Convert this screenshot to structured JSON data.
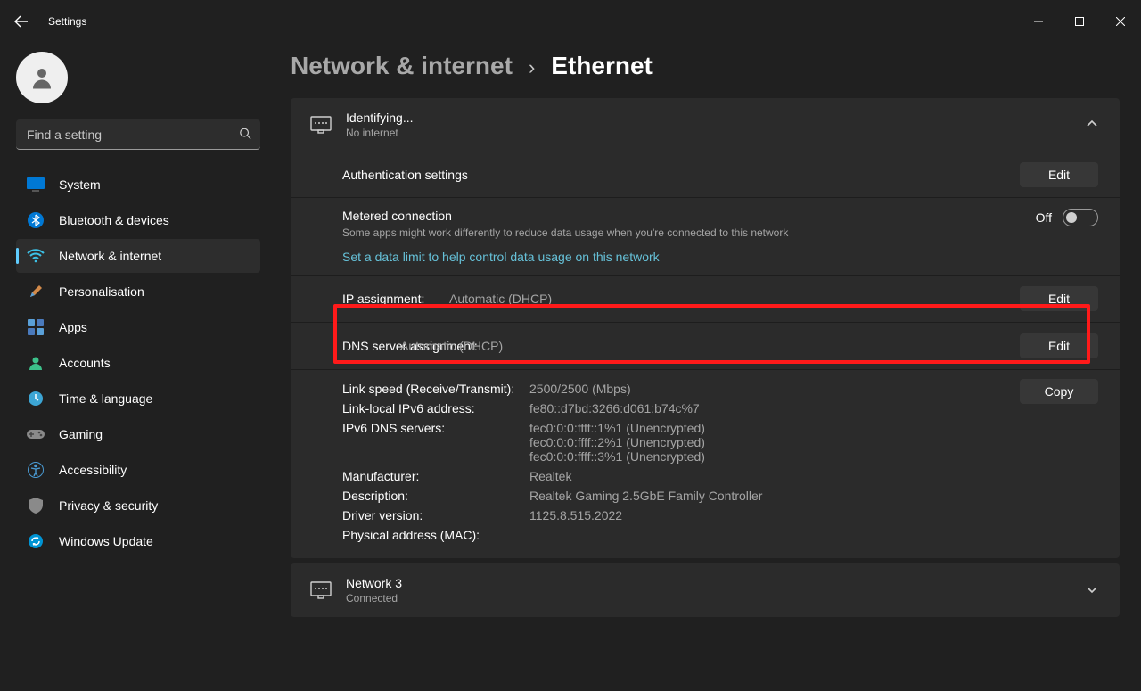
{
  "window": {
    "title": "Settings"
  },
  "search": {
    "placeholder": "Find a setting"
  },
  "sidebar": {
    "items": [
      {
        "label": "System"
      },
      {
        "label": "Bluetooth & devices"
      },
      {
        "label": "Network & internet"
      },
      {
        "label": "Personalisation"
      },
      {
        "label": "Apps"
      },
      {
        "label": "Accounts"
      },
      {
        "label": "Time & language"
      },
      {
        "label": "Gaming"
      },
      {
        "label": "Accessibility"
      },
      {
        "label": "Privacy & security"
      },
      {
        "label": "Windows Update"
      }
    ],
    "active_index": 2
  },
  "breadcrumb": {
    "parent": "Network & internet",
    "current": "Ethernet"
  },
  "adapter_card": {
    "title": "Identifying...",
    "subtitle": "No internet",
    "auth_label": "Authentication settings",
    "auth_button": "Edit",
    "metered_label": "Metered connection",
    "metered_desc": "Some apps might work differently to reduce data usage when you're connected to this network",
    "metered_state_label": "Off",
    "data_limit_link": "Set a data limit to help control data usage on this network",
    "ip_assignment_label": "IP assignment:",
    "ip_assignment_value": "Automatic (DHCP)",
    "ip_assignment_button": "Edit",
    "dns_assignment_label": "DNS server assignment:",
    "dns_assignment_value": "Automatic (DHCP)",
    "dns_assignment_button": "Edit",
    "copy_button": "Copy",
    "details": {
      "link_speed_label": "Link speed (Receive/Transmit):",
      "link_speed_value": "2500/2500 (Mbps)",
      "link_local_label": "Link-local IPv6 address:",
      "link_local_value": "fe80::d7bd:3266:d061:b74c%7",
      "dns_servers_label": "IPv6 DNS servers:",
      "dns_servers_value_1": "fec0:0:0:ffff::1%1 (Unencrypted)",
      "dns_servers_value_2": "fec0:0:0:ffff::2%1 (Unencrypted)",
      "dns_servers_value_3": "fec0:0:0:ffff::3%1 (Unencrypted)",
      "manufacturer_label": "Manufacturer:",
      "manufacturer_value": "Realtek",
      "description_label": "Description:",
      "description_value": "Realtek Gaming 2.5GbE Family Controller",
      "driver_label": "Driver version:",
      "driver_value": "1125.8.515.2022",
      "mac_label": "Physical address (MAC):"
    }
  },
  "network2": {
    "title": "Network 3",
    "subtitle": "Connected"
  }
}
